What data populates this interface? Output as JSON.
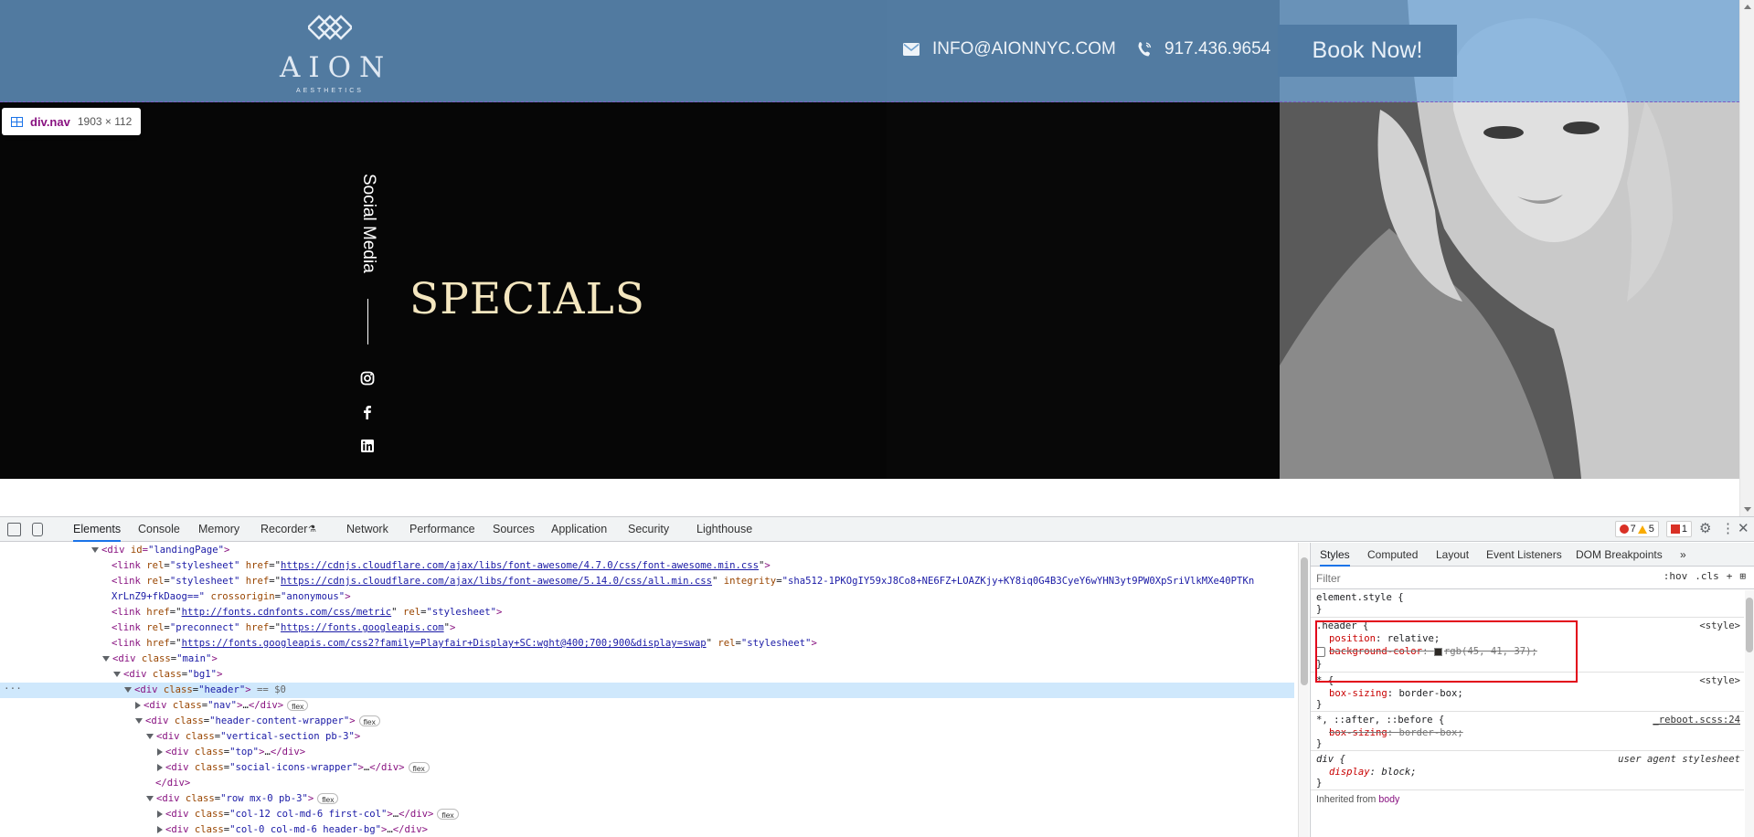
{
  "site": {
    "logo_word": "AION",
    "logo_sub": "AESTHETICS",
    "email": "INFO@AIONNYC.COM",
    "phone": "917.436.9654",
    "book_label": "Book Now!",
    "social_label": "Social Media",
    "headline": "SPECIALS",
    "social_icons": [
      "instagram-icon",
      "facebook-icon",
      "linkedin-icon"
    ]
  },
  "inspect_tooltip": {
    "name": "div.nav",
    "size": "1903 × 112"
  },
  "devtools": {
    "tabs": [
      "Elements",
      "Console",
      "Memory",
      "Recorder",
      "Network",
      "Performance",
      "Sources",
      "Application",
      "Security",
      "Lighthouse"
    ],
    "active_tab": "Elements",
    "errors": "7",
    "warnings": "5",
    "issues": "1",
    "dom_lines": [
      {
        "html": "▾<div id=\"landingPage\">"
      },
      {
        "html": "<link rel=\"stylesheet\" href=\"https://cdnjs.cloudflare.com/ajax/libs/font-awesome/4.7.0/css/font-awesome.min.css\">"
      },
      {
        "html": "<link rel=\"stylesheet\" href=\"https://cdnjs.cloudflare.com/ajax/libs/font-awesome/5.14.0/css/all.min.css\" integrity=\"sha512-1PKOgIY59xJ8Co8+NE6FZ+LOAZKjy+KY8iq0G4B3CyeY6wYHN3yt9PW0XpSriVlkMXe40PTKn"
      },
      {
        "html": "XrLnZ9+fkDaog==\" crossorigin=\"anonymous\">"
      },
      {
        "html": "<link href=\"http://fonts.cdnfonts.com/css/metric\" rel=\"stylesheet\">"
      },
      {
        "html": "<link rel=\"preconnect\" href=\"https://fonts.googleapis.com\">"
      },
      {
        "html": "<link href=\"https://fonts.googleapis.com/css2?family=Playfair+Display+SC:wght@400;700;900&display=swap\" rel=\"stylesheet\">"
      },
      {
        "html": "▾<div class=\"main\">"
      },
      {
        "html": "▾<div class=\"bg1\">"
      },
      {
        "html": "▾<div class=\"header\"> == $0"
      },
      {
        "html": "▸<div class=\"nav\">…</div>"
      },
      {
        "html": "▾<div class=\"header-content-wrapper\">"
      },
      {
        "html": "▾<div class=\"vertical-section pb-3\">"
      },
      {
        "html": "▸<div class=\"top\">…</div>"
      },
      {
        "html": "▸<div class=\"social-icons-wrapper\">…</div>"
      },
      {
        "html": "</div>"
      },
      {
        "html": "▾<div class=\"row mx-0 pb-3\">"
      },
      {
        "html": "▸<div class=\"col-12 col-md-6 first-col\">…</div>"
      },
      {
        "html": "▸<div class=\"col-0 col-md-6 header-bg\">…</div>"
      }
    ],
    "flex_badge": "flex",
    "styles_tabs": [
      "Styles",
      "Computed",
      "Layout",
      "Event Listeners",
      "DOM Breakpoints",
      "»"
    ],
    "filter_placeholder": "Filter",
    "filter_hov": ":hov",
    "filter_cls": ".cls",
    "rules": {
      "element_style": "element.style {",
      "header_selector": ".header {",
      "header_source": "<style>",
      "header_prop1": "position",
      "header_val1": "relative;",
      "header_prop2": "background-color",
      "header_val2": "rgb(45, 41, 37);",
      "star_selector": "* {",
      "star_source": "<style>",
      "star_prop": "box-sizing",
      "star_val": "border-box;",
      "reboot_selector": "*, ::after, ::before {",
      "reboot_source": "_reboot.scss:24",
      "reboot_prop": "box-sizing",
      "reboot_val": "border-box;",
      "div_selector": "div {",
      "div_source": "user agent stylesheet",
      "div_prop": "display",
      "div_val": "block;",
      "inherited": "Inherited from",
      "inherited_el": "body",
      "close": "}"
    }
  }
}
